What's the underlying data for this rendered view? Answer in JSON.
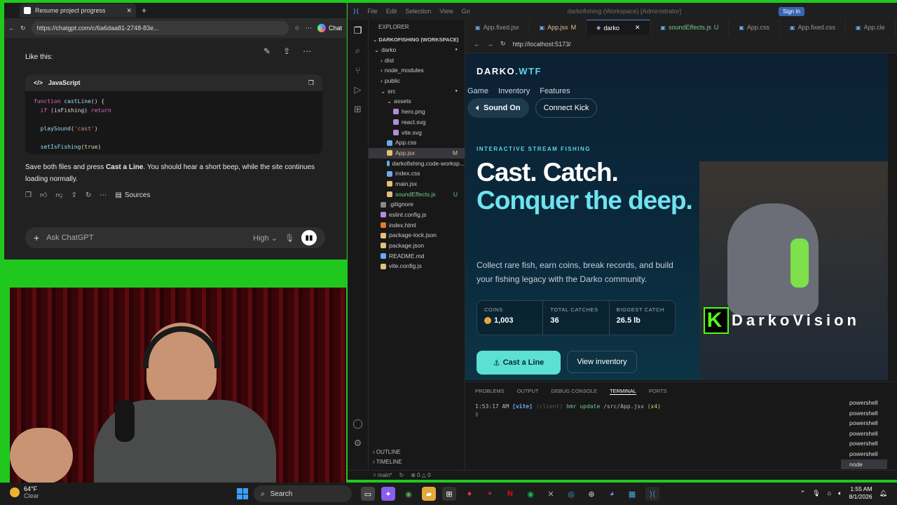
{
  "browser": {
    "tab_title": "Resume project progress",
    "url": "https://chatgpt.com/c/6a6daa81-2748-83e...",
    "chat_label": "Chat",
    "prompt_line": "Like this:",
    "code_lang": "JavaScript",
    "code": [
      {
        "parts": [
          [
            "kw",
            "function "
          ],
          [
            "fn",
            "castLine"
          ],
          [
            "",
            "() {"
          ]
        ]
      },
      {
        "parts": [
          [
            "",
            "  "
          ],
          [
            "kw",
            "if "
          ],
          [
            "",
            "(isFishing) "
          ],
          [
            "kw",
            "return"
          ]
        ]
      },
      {
        "parts": [
          [
            "",
            ""
          ]
        ]
      },
      {
        "parts": [
          [
            "",
            "  "
          ],
          [
            "fn",
            "playSound"
          ],
          [
            "",
            "("
          ],
          [
            "str",
            "'cast'"
          ],
          [
            "",
            ")"
          ]
        ]
      },
      {
        "parts": [
          [
            "",
            ""
          ]
        ]
      },
      {
        "parts": [
          [
            "",
            "  "
          ],
          [
            "fn",
            "setIsFishing"
          ],
          [
            "",
            "("
          ],
          [
            "num",
            "true"
          ],
          [
            "",
            ")"
          ]
        ]
      }
    ],
    "message_a": "Save both files and press ",
    "message_bold": "Cast a Line",
    "message_b": ". You should hear a short beep, while the site continues loading normally.",
    "sources_label": "Sources",
    "input_placeholder": "Ask ChatGPT",
    "model_label": "High"
  },
  "vscode": {
    "title": "darkofishing (Workspace) [Administrator]",
    "sign_in": "Sign In",
    "explorer_label": "EXPLORER",
    "workspace_label": "DARKOFISHING (WORKSPACE)",
    "tree": [
      {
        "name": "darko",
        "indent": 0,
        "type": "folder",
        "open": true,
        "dot": true
      },
      {
        "name": "dist",
        "indent": 1,
        "type": "folder"
      },
      {
        "name": "node_modules",
        "indent": 1,
        "type": "folder"
      },
      {
        "name": "public",
        "indent": 1,
        "type": "folder"
      },
      {
        "name": "src",
        "indent": 1,
        "type": "folder",
        "open": true,
        "dot": true
      },
      {
        "name": "assets",
        "indent": 2,
        "type": "folder",
        "open": true
      },
      {
        "name": "hero.png",
        "indent": 3,
        "type": "file",
        "color": "#b28dd8"
      },
      {
        "name": "react.svg",
        "indent": 3,
        "type": "file",
        "color": "#b28dd8"
      },
      {
        "name": "vite.svg",
        "indent": 3,
        "type": "file",
        "color": "#b28dd8"
      },
      {
        "name": "App.css",
        "indent": 2,
        "type": "file",
        "color": "#6aa9f0"
      },
      {
        "name": "App.jsx",
        "indent": 2,
        "type": "file",
        "color": "#e5c07b",
        "git": "M",
        "sel": true
      },
      {
        "name": "darkofishing.code-worksp...",
        "indent": 2,
        "type": "file",
        "color": "#6aa9f0"
      },
      {
        "name": "index.css",
        "indent": 2,
        "type": "file",
        "color": "#6aa9f0"
      },
      {
        "name": "main.jsx",
        "indent": 2,
        "type": "file",
        "color": "#e5c07b"
      },
      {
        "name": "soundEffects.js",
        "indent": 2,
        "type": "file",
        "color": "#e5c07b",
        "git": "U"
      },
      {
        "name": ".gitignore",
        "indent": 1,
        "type": "file",
        "color": "#888"
      },
      {
        "name": "eslint.config.js",
        "indent": 1,
        "type": "file",
        "color": "#b28dd8"
      },
      {
        "name": "index.html",
        "indent": 1,
        "type": "file",
        "color": "#e37933"
      },
      {
        "name": "package-lock.json",
        "indent": 1,
        "type": "file",
        "color": "#e5c07b"
      },
      {
        "name": "package.json",
        "indent": 1,
        "type": "file",
        "color": "#e5c07b"
      },
      {
        "name": "README.md",
        "indent": 1,
        "type": "file",
        "color": "#6aa9f0"
      },
      {
        "name": "vite.config.js",
        "indent": 1,
        "type": "file",
        "color": "#e5c07b"
      }
    ],
    "outline_label": "OUTLINE",
    "timeline_label": "TIMELINE",
    "tabs": [
      {
        "label": "App.fixed.jsx"
      },
      {
        "label": "App.jsx",
        "badge": "M"
      },
      {
        "label": "darko",
        "active": true
      },
      {
        "label": "soundEffects.js",
        "badge": "U"
      },
      {
        "label": "App.css"
      },
      {
        "label": "App.fixed.css"
      },
      {
        "label": "App.cle"
      }
    ],
    "preview_url": "http://localhost:5173/",
    "panel_tabs": [
      "PROBLEMS",
      "OUTPUT",
      "DEBUG CONSOLE",
      "TERMINAL",
      "PORTS"
    ],
    "terminal_time": "1:53:17 AM",
    "terminal_vite": "[vite]",
    "terminal_client": "(client)",
    "terminal_msg": "hmr update",
    "terminal_path": "/src/App.jsx",
    "terminal_count": "(x4)",
    "shells": [
      "powershell",
      "powershell",
      "powershell",
      "powershell",
      "powershell",
      "powershell",
      "node"
    ],
    "status_branch": "main*",
    "status_problems": "0",
    "status_warnings": "0"
  },
  "site": {
    "logo_a": "DARKO",
    "logo_b": ".WTF",
    "nav": [
      "Game",
      "Inventory",
      "Features"
    ],
    "sound_btn": "Sound On",
    "kick_btn": "Connect Kick",
    "eyebrow": "INTERACTIVE STREAM FISHING",
    "headline1": "Cast. Catch.",
    "headline2": "Conquer the deep.",
    "lede": "Collect rare fish, earn coins, break records, and build your fishing legacy with the Darko community.",
    "stats": [
      {
        "label": "COINS",
        "value": "1,003",
        "coin": true
      },
      {
        "label": "TOTAL CATCHES",
        "value": "36"
      },
      {
        "label": "BIGGEST CATCH",
        "value": "26.5 lb"
      }
    ],
    "cast_btn": "Cast a Line",
    "inventory_btn": "View inventory",
    "stream_brand": "DarkoVision"
  },
  "taskbar": {
    "temp": "64°F",
    "weather": "Clear",
    "search": "Search",
    "time": "1:55 AM",
    "date": "8/1/2026"
  }
}
